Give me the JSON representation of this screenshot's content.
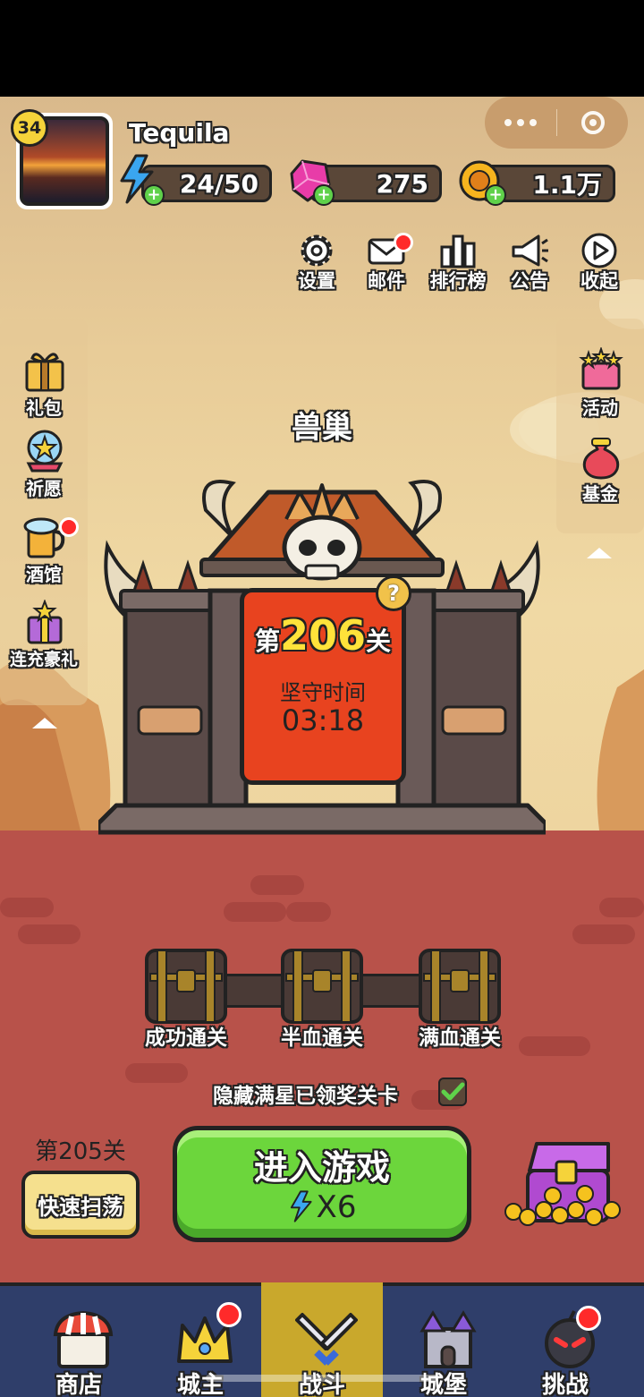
{
  "player": {
    "level": "34",
    "name": "Tequila"
  },
  "resources": {
    "energy": "24/50",
    "gems": "275",
    "gold": "1.1万"
  },
  "top_menu": [
    {
      "label": "设置",
      "icon": "gear-icon"
    },
    {
      "label": "邮件",
      "icon": "mail-icon"
    },
    {
      "label": "排行榜",
      "icon": "ranking-icon"
    },
    {
      "label": "公告",
      "icon": "megaphone-icon"
    },
    {
      "label": "收起",
      "icon": "collapse-icon"
    }
  ],
  "left_menu": [
    {
      "label": "礼包",
      "icon": "gift-icon"
    },
    {
      "label": "祈愿",
      "icon": "wish-icon"
    },
    {
      "label": "酒馆",
      "icon": "tavern-icon"
    },
    {
      "label": "连充豪礼",
      "icon": "recharge-gift-icon"
    }
  ],
  "right_menu": [
    {
      "label": "活动",
      "icon": "event-icon"
    },
    {
      "label": "基金",
      "icon": "fund-icon"
    }
  ],
  "stage": {
    "name": "兽巢",
    "prefix": "第",
    "number": "206",
    "suffix": "关",
    "hold_label": "坚守时间",
    "hold_time": "03:18"
  },
  "chests": [
    {
      "label": "成功通关"
    },
    {
      "label": "半血通关"
    },
    {
      "label": "满血通关"
    }
  ],
  "hide_toggle": {
    "label": "隐藏满星已领奖关卡",
    "checked": true
  },
  "sweep": {
    "prev_stage": "第205关",
    "button": "快速扫荡"
  },
  "play": {
    "title": "进入游戏",
    "cost": "X6"
  },
  "bottom_nav": [
    {
      "label": "商店",
      "icon": "shop-icon"
    },
    {
      "label": "城主",
      "icon": "crown-icon"
    },
    {
      "label": "战斗",
      "icon": "swords-icon"
    },
    {
      "label": "城堡",
      "icon": "castle-icon"
    },
    {
      "label": "挑战",
      "icon": "bomb-icon"
    }
  ],
  "colors": {
    "sky": "#e8cc98",
    "ground": "#b8524a",
    "play_button": "#6cd63c",
    "nav": "#2f3e6a",
    "nav_active": "#c9a82c",
    "badge": "#ff2a2a"
  }
}
